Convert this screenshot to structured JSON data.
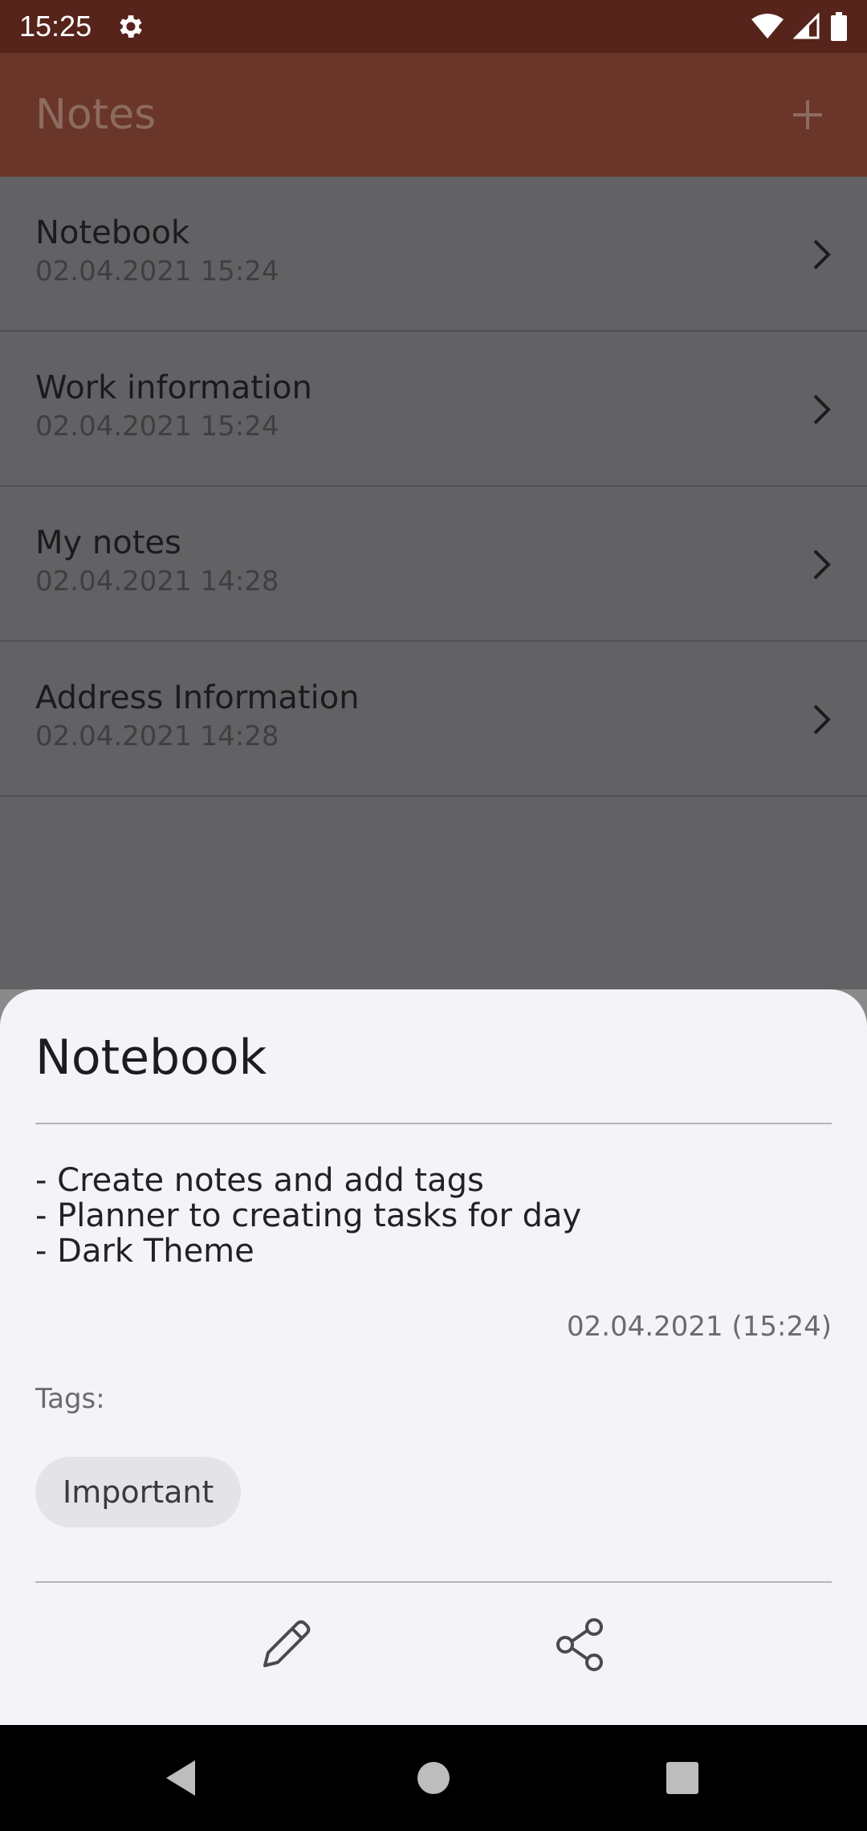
{
  "status_bar": {
    "time": "15:25",
    "icons": [
      "gear-icon",
      "wifi-icon",
      "signal-icon",
      "battery-icon"
    ]
  },
  "app_bar": {
    "title": "Notes",
    "add_icon": "plus-icon"
  },
  "notes": [
    {
      "title": "Notebook",
      "date": "02.04.2021 15:24"
    },
    {
      "title": "Work information",
      "date": "02.04.2021 15:24"
    },
    {
      "title": "My notes",
      "date": "02.04.2021 14:28"
    },
    {
      "title": "Address Information",
      "date": "02.04.2021 14:28"
    }
  ],
  "sheet": {
    "title": "Notebook",
    "body": [
      "- Create notes and add tags",
      "- Planner to creating tasks for day",
      "- Dark Theme"
    ],
    "date": "02.04.2021 (15:24)",
    "tags_label": "Tags:",
    "tags": [
      "Important"
    ],
    "actions": [
      "edit-icon",
      "share-icon"
    ]
  },
  "nav_bar": {
    "buttons": [
      "back-icon",
      "home-icon",
      "recents-icon"
    ]
  },
  "colors": {
    "status_bar": "#56241a",
    "app_bar": "#6a362a",
    "list_bg": "#626164",
    "sheet_bg": "#f4f3f8"
  }
}
